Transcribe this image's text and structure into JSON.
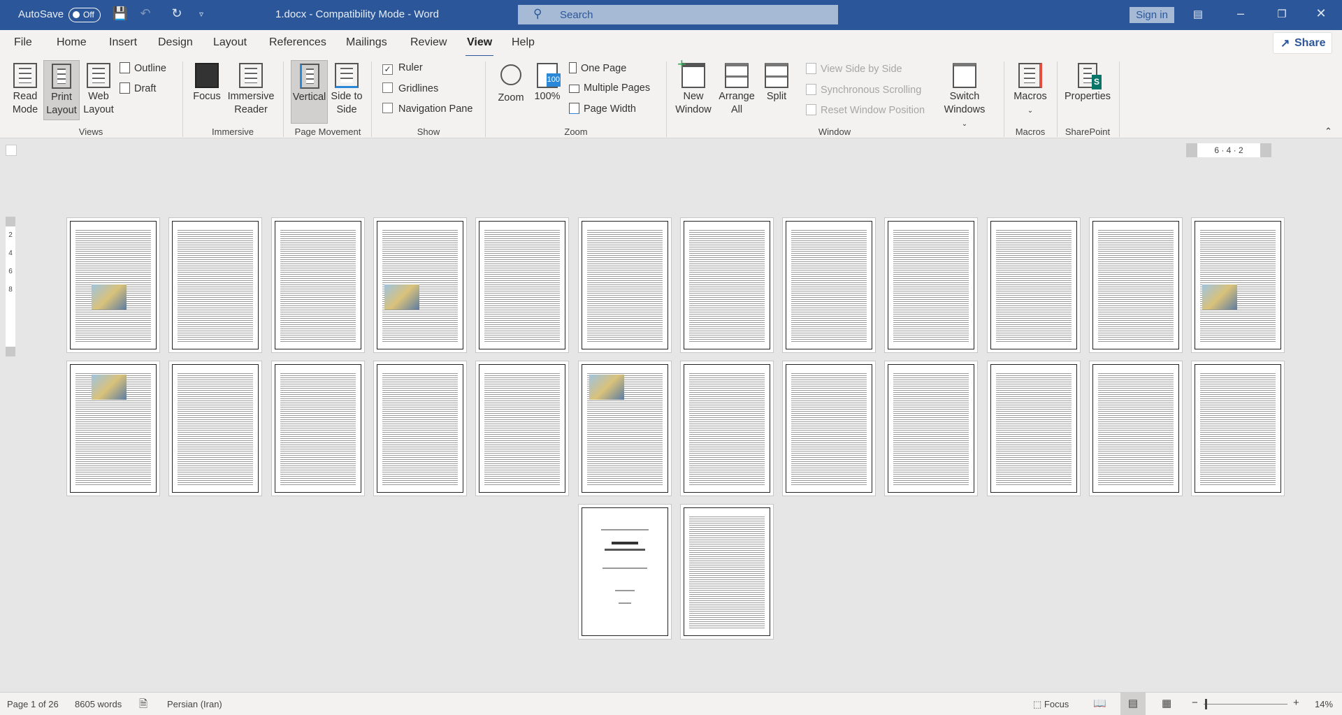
{
  "titlebar": {
    "autosave_label": "AutoSave",
    "autosave_state": "Off",
    "title": "1.docx  -  Compatibility Mode  -  Word",
    "search_placeholder": "Search",
    "sign_in": "Sign in"
  },
  "tabs": [
    "File",
    "Home",
    "Insert",
    "Design",
    "Layout",
    "References",
    "Mailings",
    "Review",
    "View",
    "Help"
  ],
  "active_tab": "View",
  "share_label": "Share",
  "ribbon": {
    "views": {
      "label": "Views",
      "read_mode": "Read Mode",
      "print_layout": "Print Layout",
      "web_layout": "Web Layout",
      "outline": "Outline",
      "draft": "Draft"
    },
    "immersive": {
      "label": "Immersive",
      "focus": "Focus",
      "immersive_reader": "Immersive Reader"
    },
    "page_movement": {
      "label": "Page Movement",
      "vertical": "Vertical",
      "side_to_side": "Side to Side"
    },
    "show": {
      "label": "Show",
      "ruler": "Ruler",
      "ruler_checked": true,
      "gridlines": "Gridlines",
      "gridlines_checked": false,
      "navigation_pane": "Navigation Pane",
      "navigation_pane_checked": false
    },
    "zoom": {
      "label": "Zoom",
      "zoom": "Zoom",
      "hundred": "100%",
      "icon_badge": "100",
      "one_page": "One Page",
      "multiple_pages": "Multiple Pages",
      "page_width": "Page Width"
    },
    "window": {
      "label": "Window",
      "new_window": "New Window",
      "arrange_all": "Arrange All",
      "split": "Split",
      "view_side_by_side": "View Side by Side",
      "synchronous_scrolling": "Synchronous Scrolling",
      "reset_window_position": "Reset Window Position",
      "switch_windows": "Switch Windows"
    },
    "macros": {
      "label": "Macros",
      "macros": "Macros"
    },
    "sharepoint": {
      "label": "SharePoint",
      "properties": "Properties"
    }
  },
  "ruler": {
    "horizontal": "6 · 4 · 2",
    "vertical": [
      "2",
      "4",
      "6",
      "8"
    ]
  },
  "document": {
    "pages_with_image": [
      1,
      4,
      12,
      13,
      18
    ],
    "total_pages": 26
  },
  "status": {
    "page": "Page 1 of 26",
    "words": "8605 words",
    "language": "Persian (Iran)",
    "focus": "Focus",
    "zoom": "14%"
  },
  "colors": {
    "brand": "#2b579a",
    "canvas": "#e6e6e6"
  }
}
